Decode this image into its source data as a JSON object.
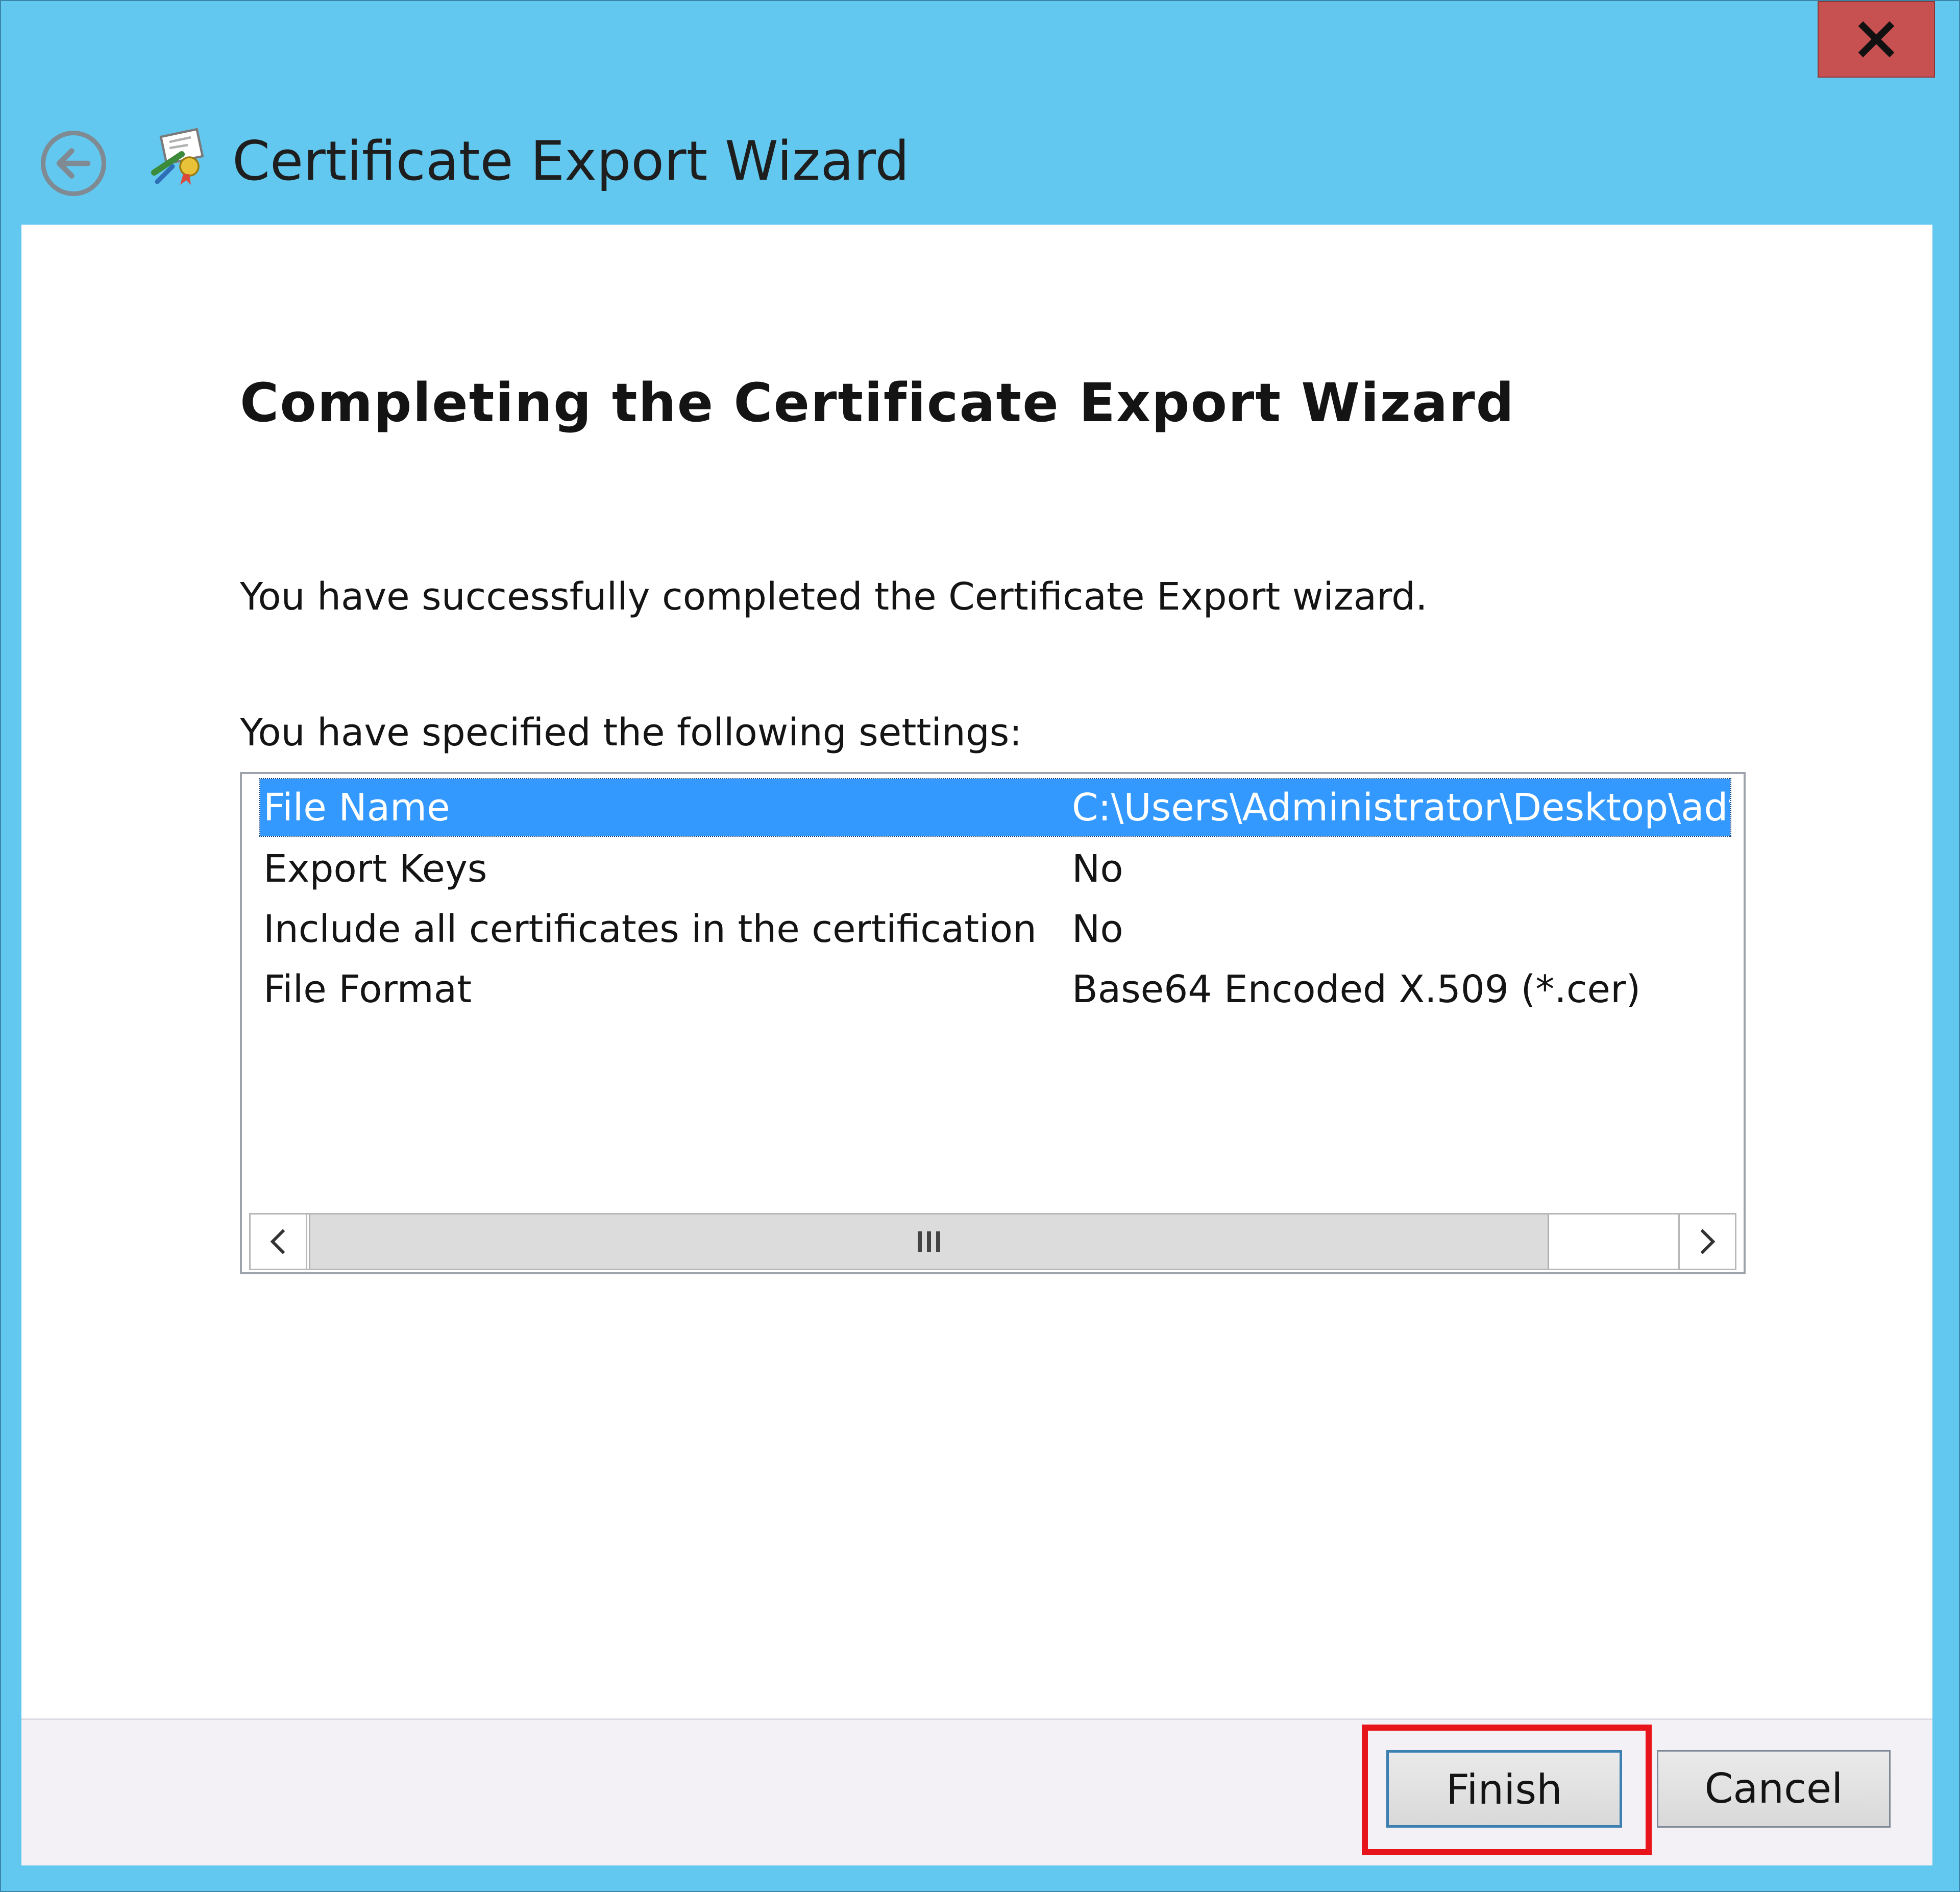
{
  "window": {
    "title": "Certificate Export Wizard",
    "close_label": "X"
  },
  "page": {
    "heading": "Completing the Certificate Export Wizard",
    "success_text": "You have successfully completed the Certificate Export wizard.",
    "settings_intro": "You have specified the following settings:"
  },
  "settings": [
    {
      "name": "File Name",
      "value": "C:\\Users\\Administrator\\Desktop\\adfs-c",
      "selected": true
    },
    {
      "name": "Export Keys",
      "value": "No"
    },
    {
      "name": "Include all certificates in the certification path",
      "value": "No"
    },
    {
      "name": "File Format",
      "value": "Base64 Encoded X.509 (*.cer)"
    }
  ],
  "buttons": {
    "finish": "Finish",
    "cancel": "Cancel"
  },
  "icons": {
    "back": "back-arrow-icon",
    "wizard": "certificate-wizard-icon",
    "close": "close-icon"
  },
  "colors": {
    "title_bar": "#63c8ef",
    "selection": "#3399ff",
    "close_button": "#c75050",
    "highlight": "#e8141b"
  }
}
